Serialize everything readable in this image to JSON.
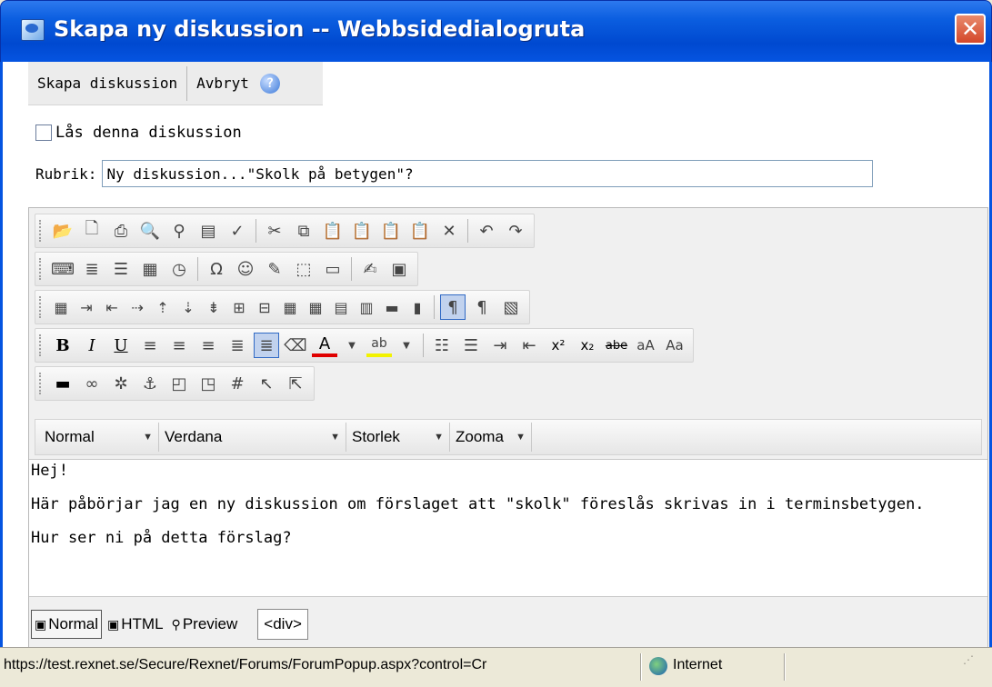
{
  "window": {
    "title": "Skapa ny diskussion -- Webbsidedialogruta",
    "close_label": "✕"
  },
  "actions": {
    "create_label": "Skapa diskussion",
    "cancel_label": "Avbryt",
    "help_icon": "help-icon"
  },
  "lock": {
    "label": "Lås denna diskussion",
    "checked": false
  },
  "rubrik": {
    "label": "Rubrik:",
    "value": "Ny diskussion...\"Skolk på betygen\"?"
  },
  "format_bar": {
    "paragraph": "Normal",
    "font": "Verdana",
    "size": "Storlek",
    "zoom": "Zooma"
  },
  "editor_content": {
    "line1": "Hej!",
    "line2": "Här påbörjar jag en ny diskussion om förslaget att \"skolk\" föreslås skrivas in i terminsbetygen.",
    "line3": "Hur ser ni på detta förslag?"
  },
  "modes": {
    "normal": "Normal",
    "html": "HTML",
    "preview": "Preview",
    "tag": "<div>"
  },
  "statusbar": {
    "url": "https://test.rexnet.se/Secure/Rexnet/Forums/ForumPopup.aspx?control=Cr",
    "zone": "Internet"
  },
  "colors": {
    "titlebar": "#0554e1",
    "close": "#d4472a",
    "background": "#ece9d8"
  }
}
